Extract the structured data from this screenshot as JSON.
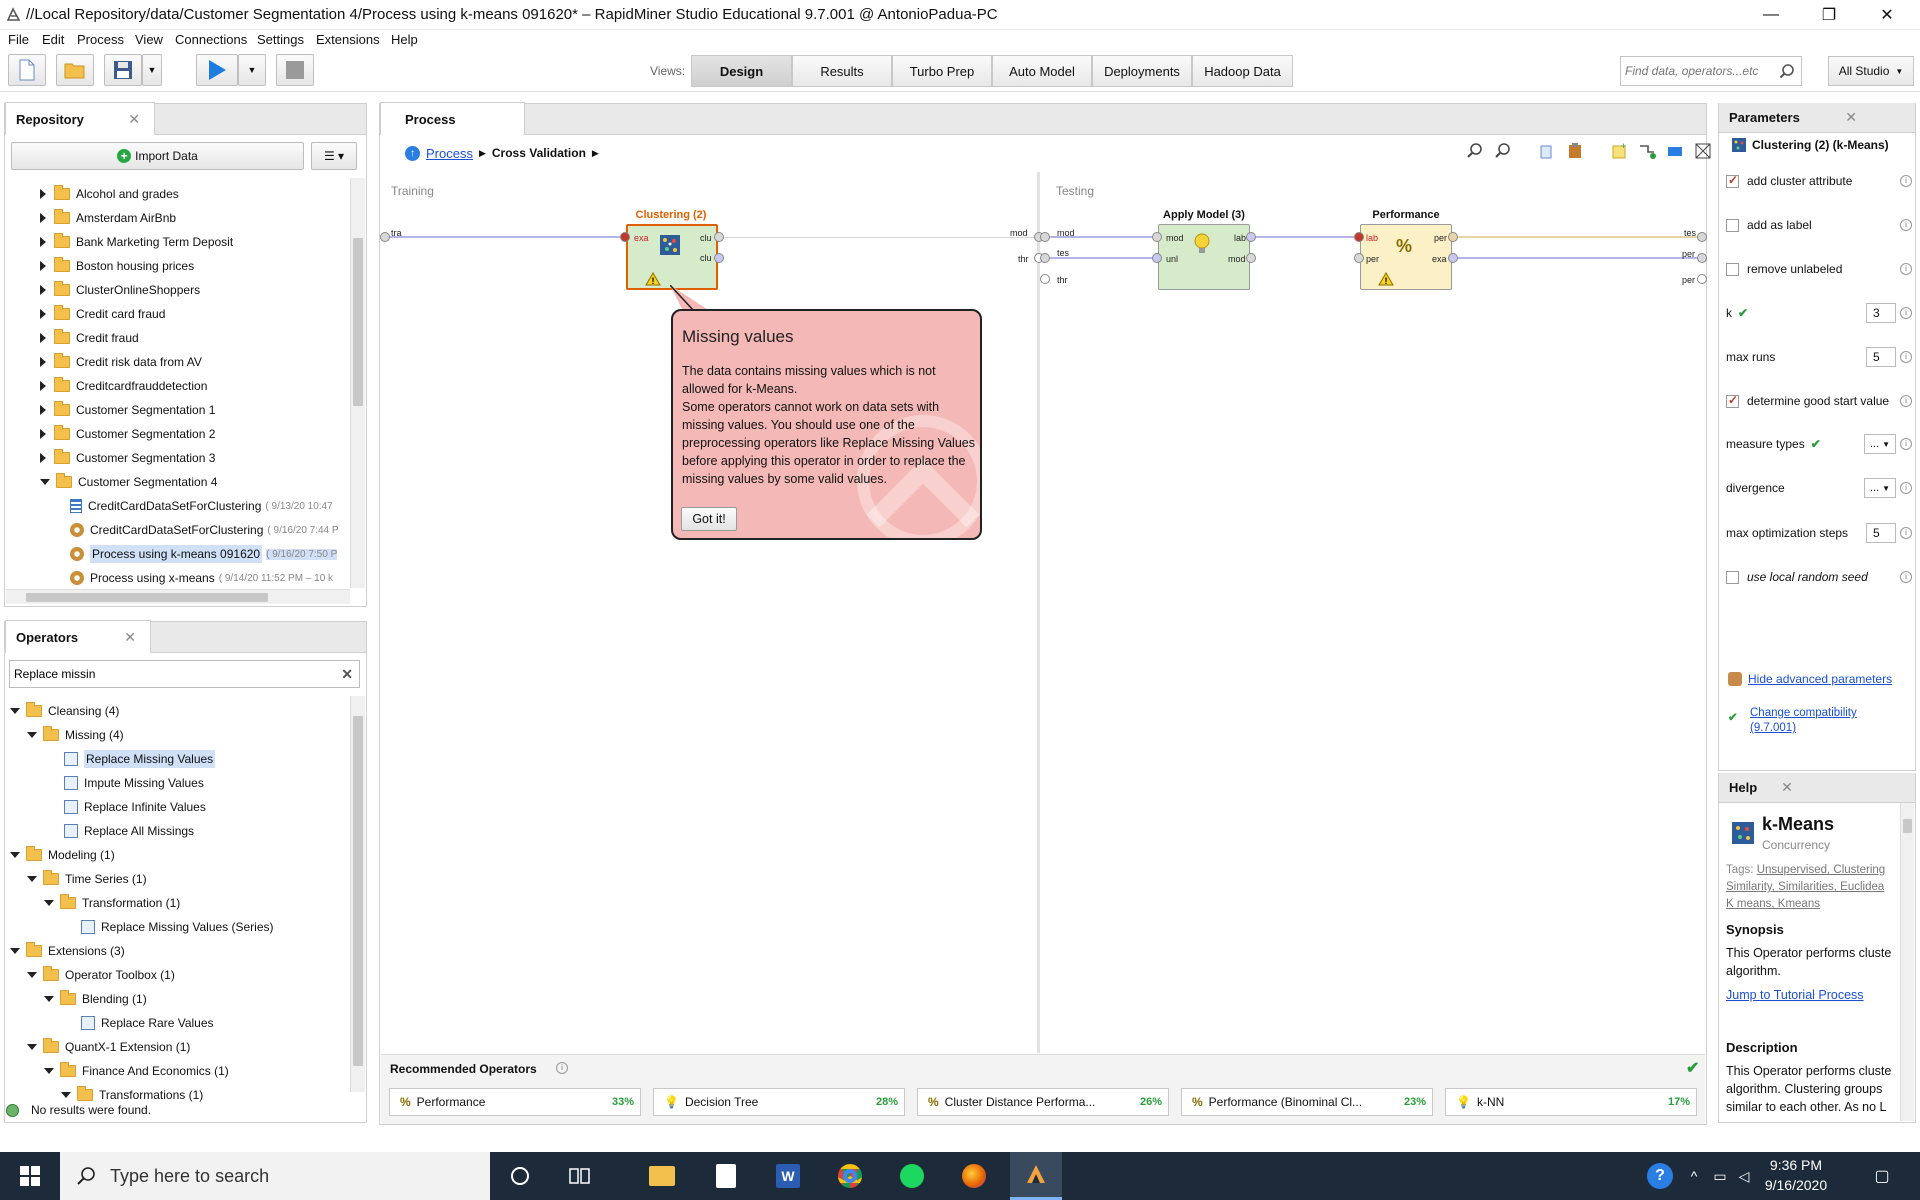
{
  "window": {
    "title": "//Local Repository/data/Customer Segmentation 4/Process using k-means 091620* – RapidMiner Studio Educational 9.7.001 @ AntonioPadua-PC",
    "minimize": "—",
    "maximize": "❐",
    "close": "✕"
  },
  "menu": [
    "File",
    "Edit",
    "Process",
    "View",
    "Connections",
    "Settings",
    "Extensions",
    "Help"
  ],
  "views": {
    "label": "Views:",
    "tabs": [
      "Design",
      "Results",
      "Turbo Prep",
      "Auto Model",
      "Deployments",
      "Hadoop Data"
    ],
    "active": "Design"
  },
  "search": {
    "placeholder": "Find data, operators...etc",
    "scope": "All Studio"
  },
  "repository": {
    "title": "Repository",
    "import_label": "Import Data",
    "items": [
      {
        "label": "Alcohol and grades",
        "type": "folder"
      },
      {
        "label": "Amsterdam AirBnb",
        "type": "folder"
      },
      {
        "label": "Bank Marketing Term Deposit",
        "type": "folder"
      },
      {
        "label": "Boston housing prices",
        "type": "folder"
      },
      {
        "label": "ClusterOnlineShoppers",
        "type": "folder"
      },
      {
        "label": "Credit card fraud",
        "type": "folder"
      },
      {
        "label": "Credit fraud",
        "type": "folder"
      },
      {
        "label": "Credit risk data from AV",
        "type": "folder"
      },
      {
        "label": "Creditcardfrauddetection",
        "type": "folder"
      },
      {
        "label": "Customer Segmentation 1",
        "type": "folder"
      },
      {
        "label": "Customer Segmentation 2",
        "type": "folder"
      },
      {
        "label": "Customer Segmentation 3",
        "type": "folder"
      },
      {
        "label": "Customer Segmentation 4",
        "type": "folder-open"
      },
      {
        "label": "CreditCardDataSetForClustering",
        "meta": "( 9/13/20 10:47",
        "type": "data"
      },
      {
        "label": "CreditCardDataSetForClustering",
        "meta": "( 9/16/20 7:44 P",
        "type": "process"
      },
      {
        "label": "Process using k-means 091620",
        "meta": "( 9/16/20 7:50 P",
        "type": "process",
        "selected": true
      },
      {
        "label": "Process using x-means",
        "meta": "( 9/14/20 11:52 PM – 10 k",
        "type": "process"
      }
    ]
  },
  "operators": {
    "title": "Operators",
    "search_value": "Replace missin",
    "status": "No results were found.",
    "tree": [
      {
        "label": "Cleansing (4)",
        "level": 0,
        "kind": "folder"
      },
      {
        "label": "Missing (4)",
        "level": 1,
        "kind": "folder"
      },
      {
        "label": "Replace Missing Values",
        "level": 2,
        "kind": "op",
        "selected": true
      },
      {
        "label": "Impute Missing Values",
        "level": 2,
        "kind": "op"
      },
      {
        "label": "Replace Infinite Values",
        "level": 2,
        "kind": "op"
      },
      {
        "label": "Replace All Missings",
        "level": 2,
        "kind": "op"
      },
      {
        "label": "Modeling (1)",
        "level": 0,
        "kind": "folder"
      },
      {
        "label": "Time Series (1)",
        "level": 1,
        "kind": "folder"
      },
      {
        "label": "Transformation (1)",
        "level": 2,
        "kind": "folder"
      },
      {
        "label": "Replace Missing Values (Series)",
        "level": 3,
        "kind": "op"
      },
      {
        "label": "Extensions (3)",
        "level": 0,
        "kind": "folder"
      },
      {
        "label": "Operator Toolbox (1)",
        "level": 1,
        "kind": "folder"
      },
      {
        "label": "Blending (1)",
        "level": 2,
        "kind": "folder"
      },
      {
        "label": "Replace Rare Values",
        "level": 3,
        "kind": "op"
      },
      {
        "label": "QuantX-1 Extension (1)",
        "level": 1,
        "kind": "folder"
      },
      {
        "label": "Finance And Economics (1)",
        "level": 2,
        "kind": "folder"
      },
      {
        "label": "Transformations (1)",
        "level": 3,
        "kind": "folder"
      }
    ]
  },
  "process": {
    "tab": "Process",
    "breadcrumb_root": "Process",
    "breadcrumb_current": "Cross Validation",
    "training_label": "Training",
    "testing_label": "Testing",
    "clustering": {
      "title": "Clustering (2)",
      "in_port": "exa",
      "out1": "clu",
      "out2": "clu"
    },
    "apply_model": {
      "title": "Apply Model (3)",
      "in1": "mod",
      "in2": "unl",
      "out1": "lab",
      "out2": "mod"
    },
    "performance": {
      "title": "Performance",
      "in1": "lab",
      "in2": "per",
      "out1": "per",
      "out2": "exa"
    },
    "training_ports": {
      "left": "tra",
      "right1": "mod",
      "right2": "thr"
    },
    "testing_ports": {
      "left1": "mod",
      "left2": "tes",
      "left3": "thr",
      "right1": "tes",
      "right2": "per",
      "right3": "per"
    }
  },
  "tooltip": {
    "title": "Missing values",
    "body1": "The data contains missing values which is not allowed for k-Means.",
    "body2": "Some operators cannot work on data sets with missing values. You should use one of the preprocessing operators like Replace Missing Values before applying this operator in order to replace the missing values by some valid values.",
    "button": "Got it!"
  },
  "recommended": {
    "title": "Recommended Operators",
    "items": [
      {
        "label": "Performance",
        "pct": "33%"
      },
      {
        "label": "Decision Tree",
        "pct": "28%"
      },
      {
        "label": "Cluster Distance Performa...",
        "pct": "26%"
      },
      {
        "label": "Performance (Binominal Cl...",
        "pct": "23%"
      },
      {
        "label": "k-NN",
        "pct": "17%"
      }
    ]
  },
  "parameters": {
    "title": "Parameters",
    "operator": "Clustering (2) (k-Means)",
    "rows": [
      {
        "label": "add cluster attribute",
        "type": "check",
        "checked": true
      },
      {
        "label": "add as label",
        "type": "check",
        "checked": false
      },
      {
        "label": "remove unlabeled",
        "type": "check",
        "checked": false
      },
      {
        "label": "k",
        "type": "input",
        "value": "3"
      },
      {
        "label": "max runs",
        "type": "input",
        "value": "5"
      },
      {
        "label": "determine good start value",
        "type": "check",
        "checked": true
      },
      {
        "label": "measure types",
        "type": "drop",
        "value": "..."
      },
      {
        "label": "divergence",
        "type": "drop",
        "value": "..."
      },
      {
        "label": "max optimization steps",
        "type": "input",
        "value": "5"
      },
      {
        "label": "use local random seed",
        "type": "check",
        "checked": false
      }
    ],
    "hide_advanced": "Hide advanced parameters",
    "compat1": "Change compatibility",
    "compat2": "(9.7.001)"
  },
  "help": {
    "title": "Help",
    "op_name": "k-Means",
    "subtitle": "Concurrency",
    "tags_label": "Tags:",
    "tags_line1": "Unsupervised, Clustering",
    "tags_line2": "Similarity, Similarities, Euclidea",
    "tags_line3": "K means, Kmeans",
    "synopsis_h": "Synopsis",
    "synopsis_1": "This Operator performs cluste",
    "synopsis_2": "algorithm.",
    "tutorial": "Jump to Tutorial Process",
    "desc_h": "Description",
    "desc_1": "This Operator performs cluste",
    "desc_2": "algorithm. Clustering groups",
    "desc_3": "similar to each other. As no L"
  },
  "taskbar": {
    "search_placeholder": "Type here to search",
    "time": "9:36 PM",
    "date": "9/16/2020"
  },
  "colors": {
    "tooltip_bg": "#f4b9b6",
    "op_green": "#d6ebc9",
    "op_yellow": "#fbf0c6",
    "accent_orange": "#e06000",
    "link": "#1a4fd6"
  }
}
